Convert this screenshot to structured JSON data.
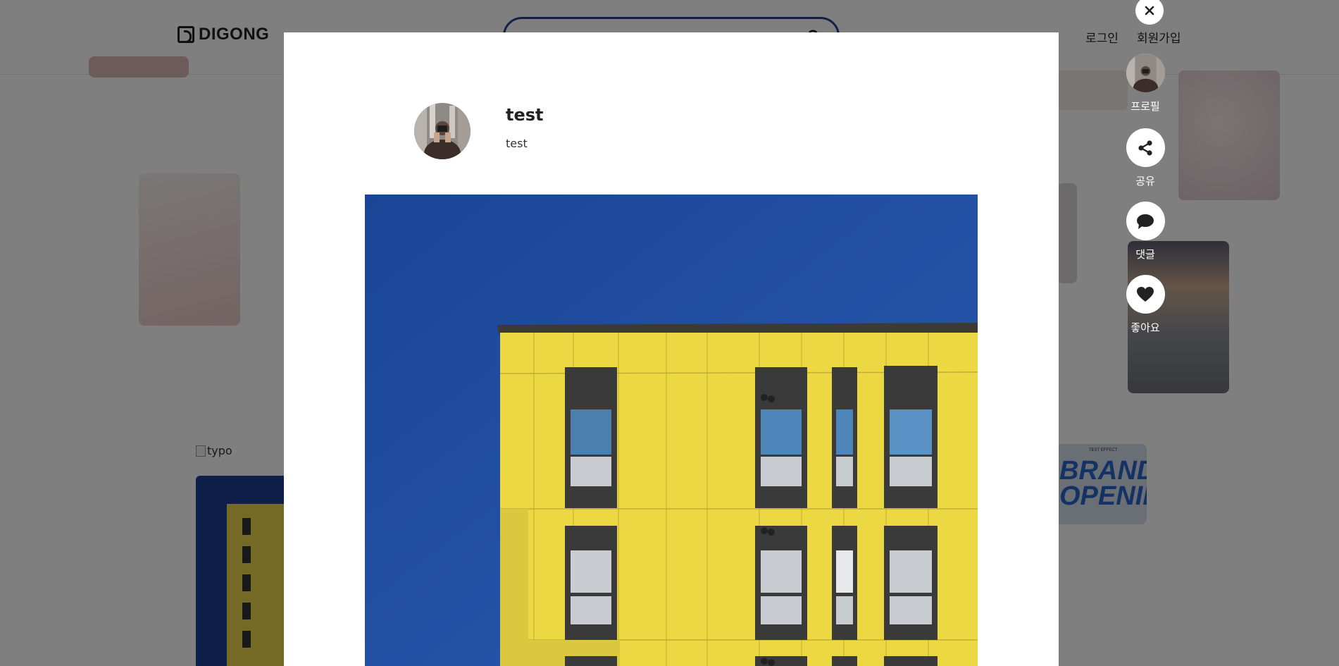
{
  "header": {
    "logo_text": "DIGONG",
    "search": {
      "value": "",
      "placeholder": ""
    },
    "nav": {
      "login": "로그인",
      "signup": "회원가입"
    }
  },
  "background": {
    "broken_image_alt": "typo",
    "card_text": {
      "top": "TEST EFFECT",
      "main": "BRAND\nOPENING"
    }
  },
  "modal": {
    "author": {
      "name": "test",
      "subtitle": "test"
    }
  },
  "side_actions": {
    "profile": "프로필",
    "share": "공유",
    "comment": "댓글",
    "like": "좋아요"
  },
  "colors": {
    "overlay": "rgba(0,0,0,0.5)",
    "search_border": "#2b3f8e",
    "sky_blue": "#1d4a9c",
    "building_yellow": "#ecd842"
  }
}
